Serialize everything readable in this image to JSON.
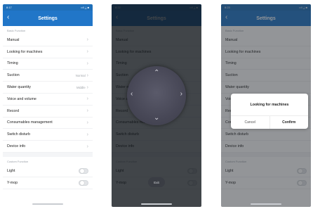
{
  "status": {
    "time": "8:17",
    "time2": "8:22",
    "time3": "8:23",
    "icons": "••ll ⟂ ■"
  },
  "header": {
    "title": "Settings",
    "back": "‹"
  },
  "sections": {
    "basic": "Basic Function",
    "custom": "Custom Function"
  },
  "rows": [
    {
      "label": "Manual",
      "value": ""
    },
    {
      "label": "Looking for machines",
      "value": ""
    },
    {
      "label": "Timing",
      "value": ""
    },
    {
      "label": "Suction",
      "value": "Normal"
    },
    {
      "label": "Water quantity",
      "value": "Middle"
    },
    {
      "label": "Voice and volume",
      "value": ""
    },
    {
      "label": "Record",
      "value": ""
    },
    {
      "label": "Consumables management",
      "value": ""
    },
    {
      "label": "Switch disturb",
      "value": ""
    },
    {
      "label": "Device info",
      "value": ""
    }
  ],
  "toggles": [
    {
      "label": "Light",
      "on": false
    },
    {
      "label": "Y-mop",
      "on": false
    }
  ],
  "remote": {
    "exit_label": "Exit",
    "up": "⌃",
    "down": "⌄",
    "left": "‹",
    "right": "›"
  },
  "dialog": {
    "title": "Looking for machines",
    "cancel": "Cancel",
    "confirm": "Confirm"
  },
  "colors": {
    "header": "#2176c8",
    "status": "#1f6fb8"
  }
}
